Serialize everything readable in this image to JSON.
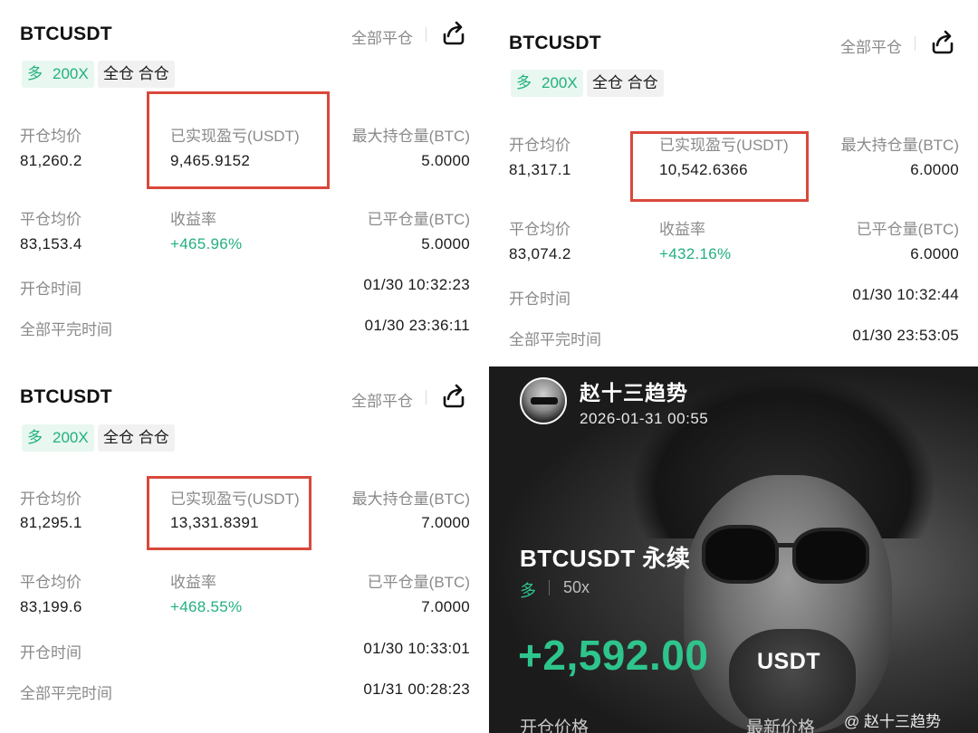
{
  "panels": [
    {
      "symbol": "BTCUSDT",
      "close_all": "全部平仓",
      "tags": [
        "多",
        "200X",
        "全仓 合仓"
      ],
      "rows": {
        "avg_open_label": "开仓均价",
        "avg_open": "81,260.2",
        "realized_label": "已实现盈亏(USDT)",
        "realized": "9,465.9152",
        "max_pos_label": "最大持仓量(BTC)",
        "max_pos": "5.0000",
        "avg_close_label": "平仓均价",
        "avg_close": "83,153.4",
        "roi_label": "收益率",
        "roi": "+465.96%",
        "closed_label": "已平仓量(BTC)",
        "closed": "5.0000",
        "open_time_label": "开仓时间",
        "open_time": "01/30 10:32:23",
        "close_time_label": "全部平完时间",
        "close_time": "01/30 23:36:11"
      }
    },
    {
      "symbol": "BTCUSDT",
      "close_all": "全部平仓",
      "tags": [
        "多",
        "200X",
        "全仓 合仓"
      ],
      "rows": {
        "avg_open_label": "开仓均价",
        "avg_open": "81,317.1",
        "realized_label": "已实现盈亏(USDT)",
        "realized": "10,542.6366",
        "max_pos_label": "最大持仓量(BTC)",
        "max_pos": "6.0000",
        "avg_close_label": "平仓均价",
        "avg_close": "83,074.2",
        "roi_label": "收益率",
        "roi": "+432.16%",
        "closed_label": "已平仓量(BTC)",
        "closed": "6.0000",
        "open_time_label": "开仓时间",
        "open_time": "01/30 10:32:44",
        "close_time_label": "全部平完时间",
        "close_time": "01/30 23:53:05"
      }
    },
    {
      "symbol": "BTCUSDT",
      "close_all": "全部平仓",
      "tags": [
        "多",
        "200X",
        "全仓 合仓"
      ],
      "rows": {
        "avg_open_label": "开仓均价",
        "avg_open": "81,295.1",
        "realized_label": "已实现盈亏(USDT)",
        "realized": "13,331.8391",
        "max_pos_label": "最大持仓量(BTC)",
        "max_pos": "7.0000",
        "avg_close_label": "平仓均价",
        "avg_close": "83,199.6",
        "roi_label": "收益率",
        "roi": "+468.55%",
        "closed_label": "已平仓量(BTC)",
        "closed": "7.0000",
        "open_time_label": "开仓时间",
        "open_time": "01/30 10:33:01",
        "close_time_label": "全部平完时间",
        "close_time": "01/31 00:28:23"
      }
    }
  ],
  "card": {
    "author": "赵十三趋势",
    "datetime": "2026-01-31 00:55",
    "symbol": "BTCUSDT 永续",
    "direction": "多",
    "leverage": "50x",
    "pnl": "+2,592.00",
    "pnl_unit": "USDT",
    "watermark": "@ 赵十三趋势",
    "open_price_label": "开仓价格",
    "last_price_label": "最新价格"
  },
  "colors": {
    "profit_green": "#22b07d",
    "highlight_red": "#d9483b",
    "label_gray": "#8a8a8a"
  },
  "icons": [
    "share-icon",
    "avatar"
  ]
}
